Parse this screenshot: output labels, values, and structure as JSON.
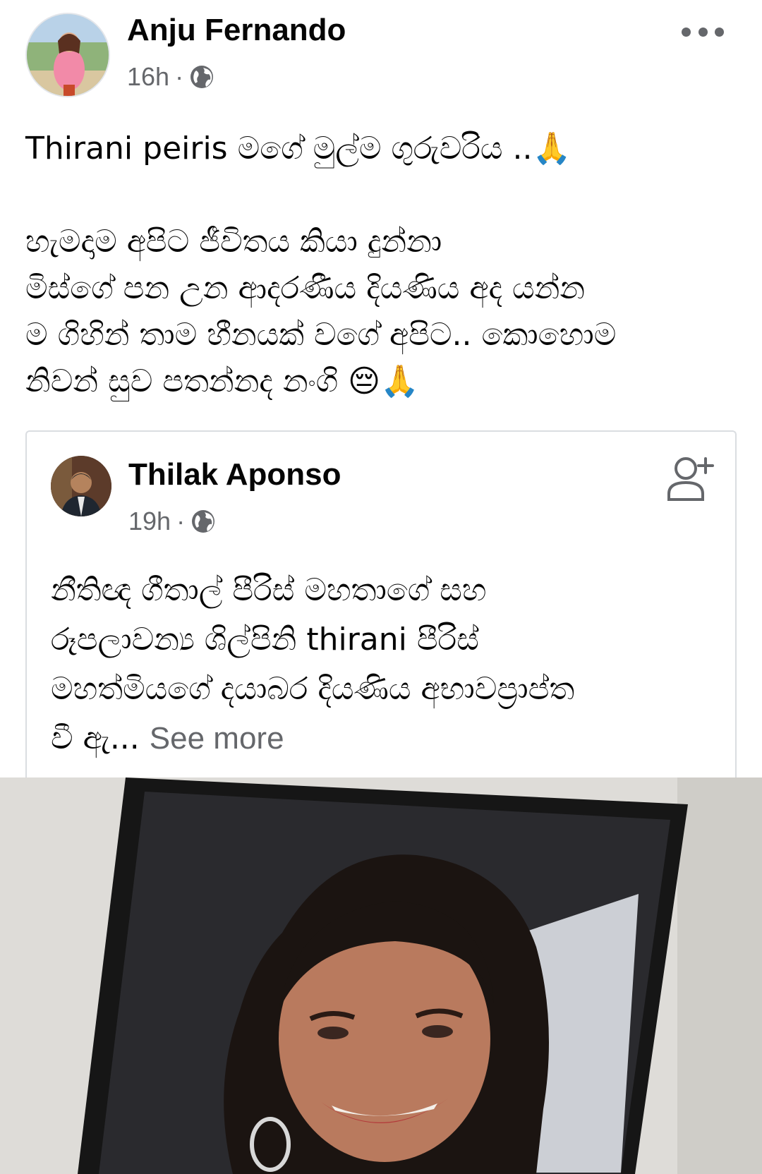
{
  "post": {
    "author": "Anju Fernando",
    "time": "16h",
    "separator": "·",
    "privacy_icon": "globe-icon",
    "more_icon": "more-options-icon",
    "text_line1": "Thirani peiris මගේ මුල්ම ගුරුවරිය ..🙏",
    "text_line2": "හැමදාම අපිට ජීවිතය කියා දුන්නා",
    "text_line3": "මිස්ගේ පන උන ආදරණීය දියණිය අද යන්න",
    "text_line4": "ම ගිහින් තාම හීනයක් වගේ අපිට.. කොහොම",
    "text_line5": "නිවන් සුව පතන්නද නංගි 😔🙏"
  },
  "shared": {
    "author": "Thilak Aponso",
    "time": "19h",
    "separator": "·",
    "privacy_icon": "globe-icon",
    "add_friend_icon": "add-friend-icon",
    "text_line1": "නීතිඥ ගීතාල් පීරිස් මහතාගේ සහ",
    "text_line2": "රූපලාවන්‍ය ශිල්පිනි thirani පීරිස්",
    "text_line3": "මහත්මියගේ දයාබර දියණිය අභාවප්‍රාප්ත",
    "text_line4": "වී ඇ...",
    "see_more": "See more"
  },
  "colors": {
    "text_primary": "#050505",
    "text_secondary": "#65676b",
    "card_border": "#dadde1"
  }
}
